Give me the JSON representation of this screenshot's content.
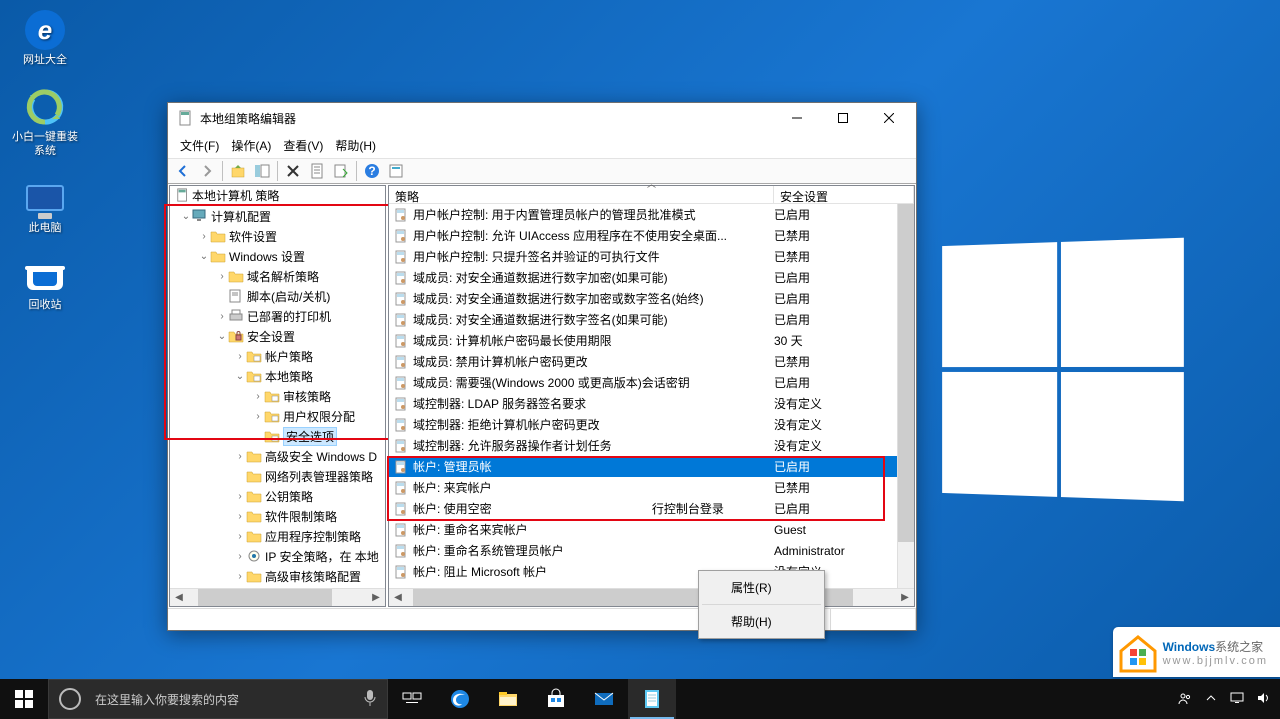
{
  "desktop_icons": [
    {
      "name": "ie-icon",
      "label": "网址大全"
    },
    {
      "name": "reinstall-icon",
      "label": "小白一键重装系统"
    },
    {
      "name": "this-pc-icon",
      "label": "此电脑"
    },
    {
      "name": "recycle-bin-icon",
      "label": "回收站"
    }
  ],
  "window": {
    "title": "本地组策略编辑器",
    "menu": [
      "文件(F)",
      "操作(A)",
      "查看(V)",
      "帮助(H)"
    ],
    "tree_header": "本地计算机 策略",
    "tree": [
      {
        "indent": 0,
        "tw": "v",
        "i": "computer",
        "label": "计算机配置"
      },
      {
        "indent": 1,
        "tw": ">",
        "i": "folder",
        "label": "软件设置"
      },
      {
        "indent": 1,
        "tw": "v",
        "i": "folder",
        "label": "Windows 设置"
      },
      {
        "indent": 2,
        "tw": ">",
        "i": "folder",
        "label": "域名解析策略"
      },
      {
        "indent": 2,
        "tw": "",
        "i": "script",
        "label": "脚本(启动/关机)"
      },
      {
        "indent": 2,
        "tw": ">",
        "i": "printer",
        "label": "已部署的打印机"
      },
      {
        "indent": 2,
        "tw": "v",
        "i": "lock",
        "label": "安全设置"
      },
      {
        "indent": 3,
        "tw": ">",
        "i": "folderp",
        "label": "帐户策略"
      },
      {
        "indent": 3,
        "tw": "v",
        "i": "folderp",
        "label": "本地策略"
      },
      {
        "indent": 4,
        "tw": ">",
        "i": "folderp",
        "label": "审核策略"
      },
      {
        "indent": 4,
        "tw": ">",
        "i": "folderp",
        "label": "用户权限分配"
      },
      {
        "indent": 4,
        "tw": "",
        "i": "folderp",
        "label": "安全选项",
        "selected": true
      },
      {
        "indent": 3,
        "tw": ">",
        "i": "folder",
        "label": "高级安全 Windows D"
      },
      {
        "indent": 3,
        "tw": "",
        "i": "folder",
        "label": "网络列表管理器策略"
      },
      {
        "indent": 3,
        "tw": ">",
        "i": "folder",
        "label": "公钥策略"
      },
      {
        "indent": 3,
        "tw": ">",
        "i": "folder",
        "label": "软件限制策略"
      },
      {
        "indent": 3,
        "tw": ">",
        "i": "folder",
        "label": "应用程序控制策略"
      },
      {
        "indent": 3,
        "tw": ">",
        "i": "ipsec",
        "label": "IP 安全策略，在 本地"
      },
      {
        "indent": 3,
        "tw": ">",
        "i": "folder",
        "label": "高级审核策略配置"
      }
    ],
    "columns": {
      "policy": "策略",
      "setting": "安全设置"
    },
    "rows": [
      {
        "p": "用户帐户控制: 用于内置管理员帐户的管理员批准模式",
        "s": "已启用"
      },
      {
        "p": "用户帐户控制: 允许 UIAccess 应用程序在不使用安全桌面...",
        "s": "已禁用"
      },
      {
        "p": "用户帐户控制: 只提升签名并验证的可执行文件",
        "s": "已禁用"
      },
      {
        "p": "域成员: 对安全通道数据进行数字加密(如果可能)",
        "s": "已启用"
      },
      {
        "p": "域成员: 对安全通道数据进行数字加密或数字签名(始终)",
        "s": "已启用"
      },
      {
        "p": "域成员: 对安全通道数据进行数字签名(如果可能)",
        "s": "已启用"
      },
      {
        "p": "域成员: 计算机帐户密码最长使用期限",
        "s": "30 天"
      },
      {
        "p": "域成员: 禁用计算机帐户密码更改",
        "s": "已禁用"
      },
      {
        "p": "域成员: 需要强(Windows 2000 或更高版本)会话密钥",
        "s": "已启用"
      },
      {
        "p": "域控制器: LDAP 服务器签名要求",
        "s": "没有定义"
      },
      {
        "p": "域控制器: 拒绝计算机帐户密码更改",
        "s": "没有定义"
      },
      {
        "p": "域控制器: 允许服务器操作者计划任务",
        "s": "没有定义"
      },
      {
        "p": "帐户: 管理员帐",
        "s": "已启用",
        "selected": true
      },
      {
        "p": "帐户: 来宾帐户",
        "s": "已禁用"
      },
      {
        "p": "帐户: 使用空密",
        "s2": "行控制台登录",
        "s": "已启用"
      },
      {
        "p": "帐户: 重命名来宾帐户",
        "s": "Guest"
      },
      {
        "p": "帐户: 重命名系统管理员帐户",
        "s": "Administrator"
      },
      {
        "p": "帐户: 阻止 Microsoft 帐户",
        "s": "没有定义"
      }
    ],
    "context_menu": [
      "属性(R)",
      "帮助(H)"
    ]
  },
  "taskbar": {
    "search_placeholder": "在这里输入你要搜索的内容"
  },
  "watermark": {
    "line1a": "Windows",
    "line1b": "系统之家",
    "line2": "www.bjjmlv.com"
  }
}
